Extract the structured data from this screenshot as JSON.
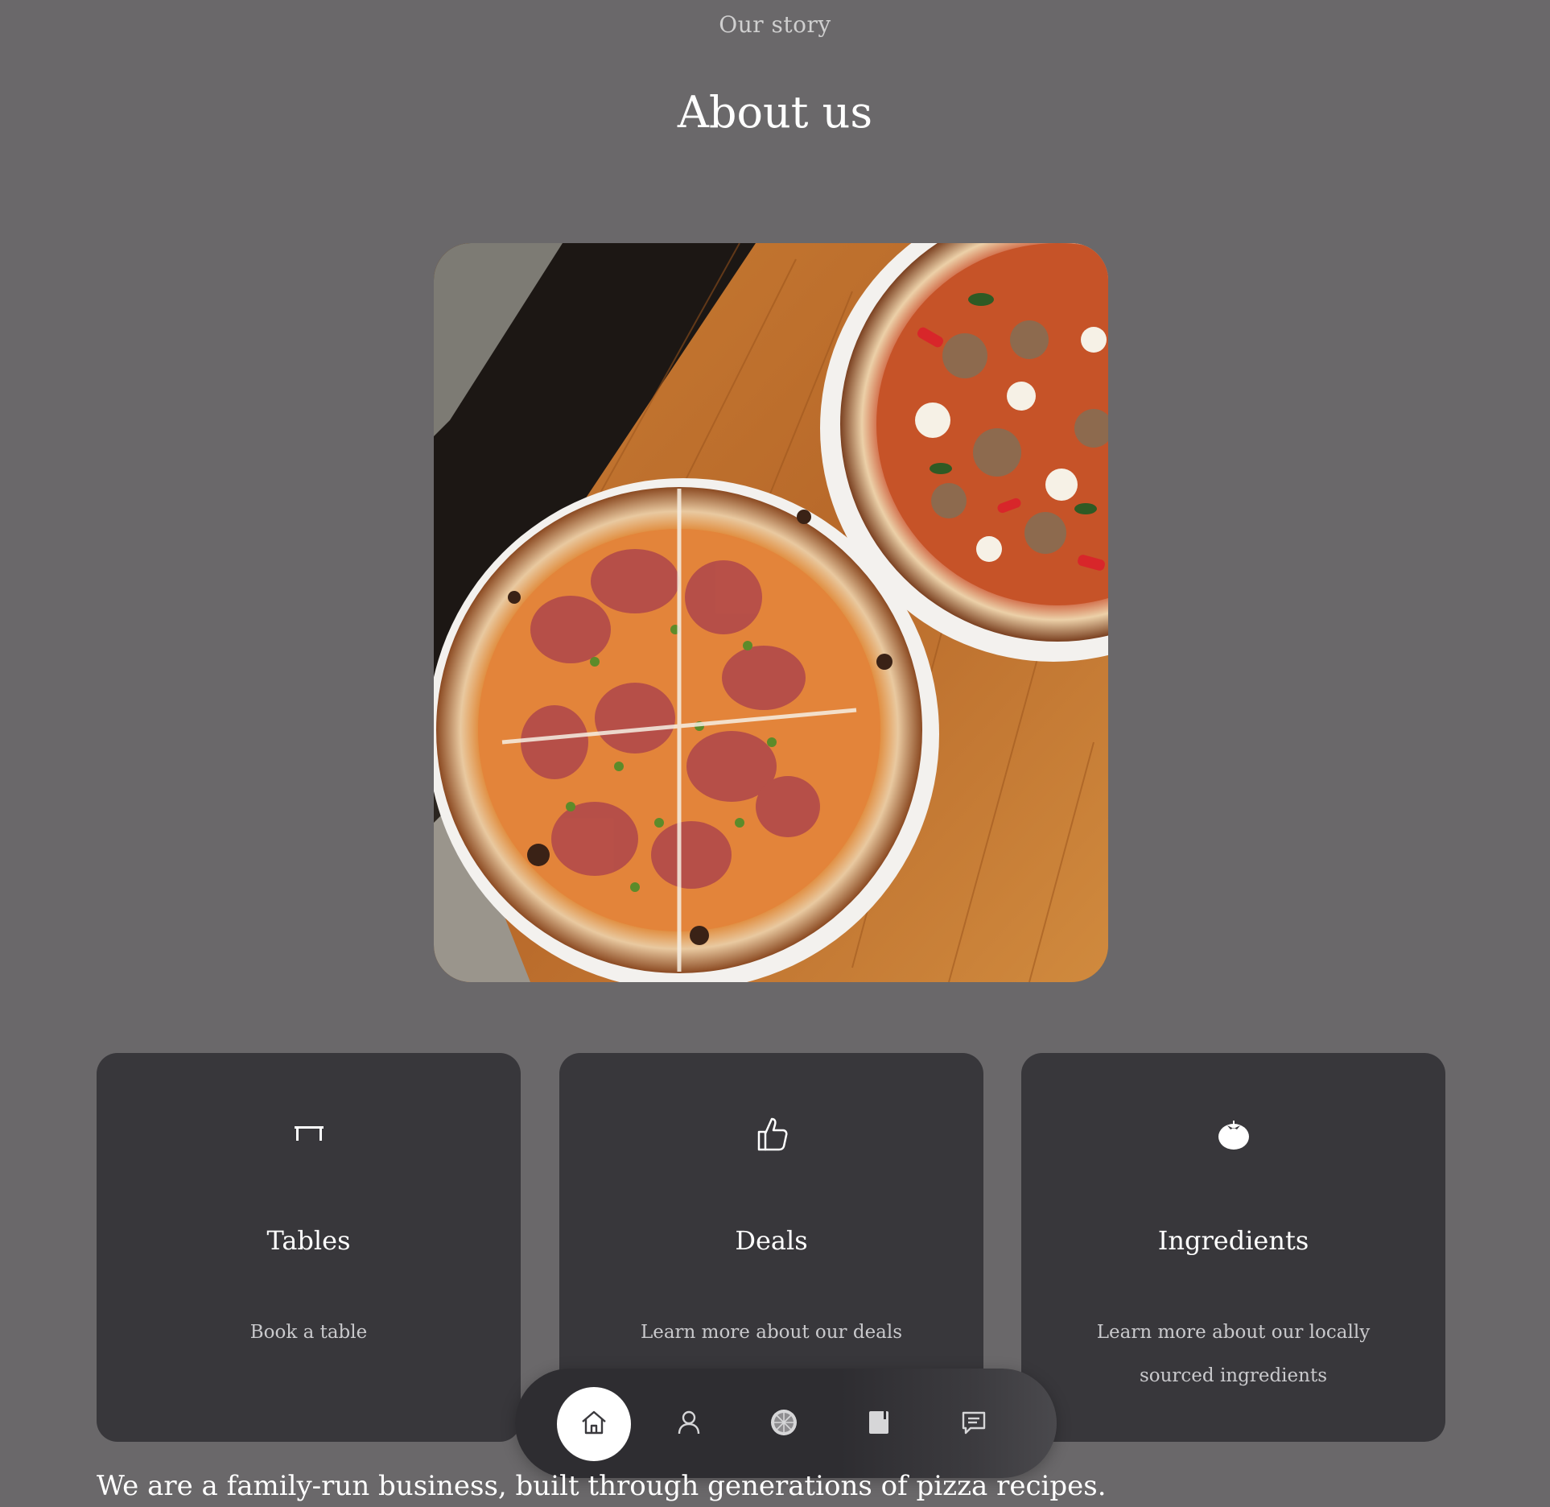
{
  "header": {
    "eyebrow": "Our story",
    "title": "About us"
  },
  "cards": [
    {
      "icon": "table-icon",
      "title": "Tables",
      "text": "Book a table"
    },
    {
      "icon": "thumbs-up-icon",
      "title": "Deals",
      "text": "Learn more about our deals"
    },
    {
      "icon": "tomato-icon",
      "title": "Ingredients",
      "text": "Learn more about our locally sourced ingredients"
    }
  ],
  "nav": {
    "items": [
      {
        "icon": "home-icon",
        "active": true
      },
      {
        "icon": "user-icon",
        "active": false
      },
      {
        "icon": "pizza-icon",
        "active": false
      },
      {
        "icon": "book-icon",
        "active": false
      },
      {
        "icon": "chat-icon",
        "active": false
      }
    ]
  },
  "intro": {
    "text": "We are a family-run business, built through generations of pizza recipes."
  },
  "colors": {
    "background": "#6a686a",
    "card": "#38373b",
    "nav": "#2e2d31",
    "accent_white": "#ffffff"
  }
}
